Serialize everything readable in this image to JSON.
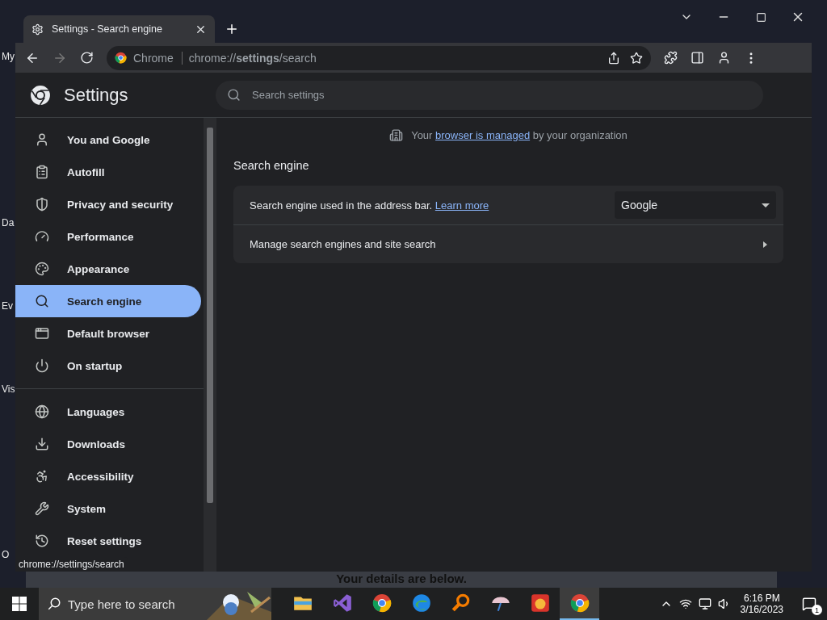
{
  "desktop": {
    "icon_labels": [
      {
        "label": "My"
      },
      {
        "label": "Da"
      },
      {
        "label": "Ev"
      },
      {
        "label": "Vis"
      },
      {
        "label": "O"
      }
    ],
    "background_window": {
      "text": "Your details are below."
    }
  },
  "browser": {
    "tab": {
      "title": "Settings - Search engine",
      "selected": true
    },
    "omnibox": {
      "origin": "Chrome",
      "url": "chrome://**settings**/search"
    },
    "status_bubble": "chrome://settings/search"
  },
  "settings": {
    "title": "Settings",
    "search": {
      "placeholder": "Search settings"
    },
    "nav_groups": [
      [
        {
          "label": "You and Google",
          "selected": false
        },
        {
          "label": "Autofill",
          "selected": false
        },
        {
          "label": "Privacy and security",
          "selected": false
        },
        {
          "label": "Performance",
          "selected": false
        },
        {
          "label": "Appearance",
          "selected": false
        },
        {
          "label": "Search engine",
          "selected": true
        },
        {
          "label": "Default browser",
          "selected": false
        },
        {
          "label": "On startup",
          "selected": false
        }
      ],
      [
        {
          "label": "Languages",
          "selected": false
        },
        {
          "label": "Downloads",
          "selected": false
        },
        {
          "label": "Accessibility",
          "selected": false
        },
        {
          "label": "System",
          "selected": false
        },
        {
          "label": "Reset settings",
          "selected": false
        }
      ]
    ],
    "managed_notice": {
      "before": "Your",
      "link": "browser is managed",
      "after": "by your organization"
    },
    "section_title": "Search engine",
    "rows": [
      {
        "kind": "select",
        "label": "Search engine used in the address bar.",
        "link": "Learn more",
        "value": "Google"
      },
      {
        "kind": "submenu",
        "label": "Manage search engines and site search"
      }
    ]
  },
  "taskbar": {
    "search": {
      "placeholder": "Type here to search"
    },
    "apps": [
      {
        "active": false
      },
      {
        "active": false
      },
      {
        "active": false
      },
      {
        "active": false
      },
      {
        "active": false
      },
      {
        "active": false
      },
      {
        "active": false
      },
      {
        "active": true
      }
    ],
    "clock": {
      "time": "6:16 PM",
      "date": "3/16/2023"
    },
    "notifications": "1"
  }
}
